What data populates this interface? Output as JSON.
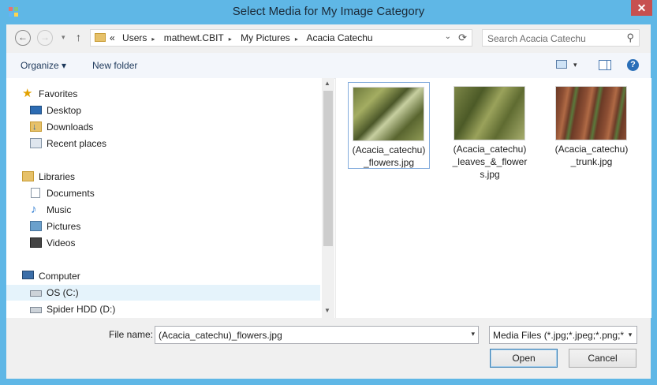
{
  "window": {
    "title": "Select Media for My Image Category",
    "close_glyph": "✕"
  },
  "address": {
    "back_glyph": "←",
    "forward_glyph": "→",
    "history_glyph": "▾",
    "up_glyph": "↑",
    "overflow": "«",
    "crumbs": [
      "Users",
      "mathewt.CBIT",
      "My Pictures",
      "Acacia Catechu"
    ],
    "sep": "▸",
    "dropdown_glyph": "⌄",
    "refresh_glyph": "⟳",
    "search_placeholder": "Search Acacia Catechu",
    "search_glyph": "⚲"
  },
  "toolbar": {
    "organize": "Organize ▾",
    "new_folder": "New folder",
    "view_drop": "▾",
    "help": "?"
  },
  "nav": {
    "favorites": "Favorites",
    "desktop": "Desktop",
    "downloads": "Downloads",
    "recent": "Recent places",
    "libraries": "Libraries",
    "documents": "Documents",
    "music": "Music",
    "pictures": "Pictures",
    "videos": "Videos",
    "computer": "Computer",
    "os_c": "OS (C:)",
    "spider": "Spider HDD (D:)",
    "star_glyph": "★",
    "music_glyph": "♪",
    "scroll_up": "▲",
    "scroll_down": "▼"
  },
  "files": [
    {
      "line1": "(Acacia_catechu)",
      "line2": "_flowers.jpg",
      "line3": ""
    },
    {
      "line1": "(Acacia_catechu)",
      "line2": "_leaves_&_flower",
      "line3": "s.jpg"
    },
    {
      "line1": "(Acacia_catechu)",
      "line2": "_trunk.jpg",
      "line3": ""
    }
  ],
  "bottom": {
    "filename_label": "File name:",
    "filename_value": "(Acacia_catechu)_flowers.jpg",
    "filetype_value": "Media Files (*.jpg;*.jpeg;*.png;*",
    "dropdown_glyph": "▾",
    "open": "Open",
    "cancel": "Cancel"
  },
  "colors": {
    "titlebar": "#5fb7e6",
    "close_button": "#c75050",
    "selection": "#e5f3fb",
    "accent_border": "#3c7fb1"
  }
}
